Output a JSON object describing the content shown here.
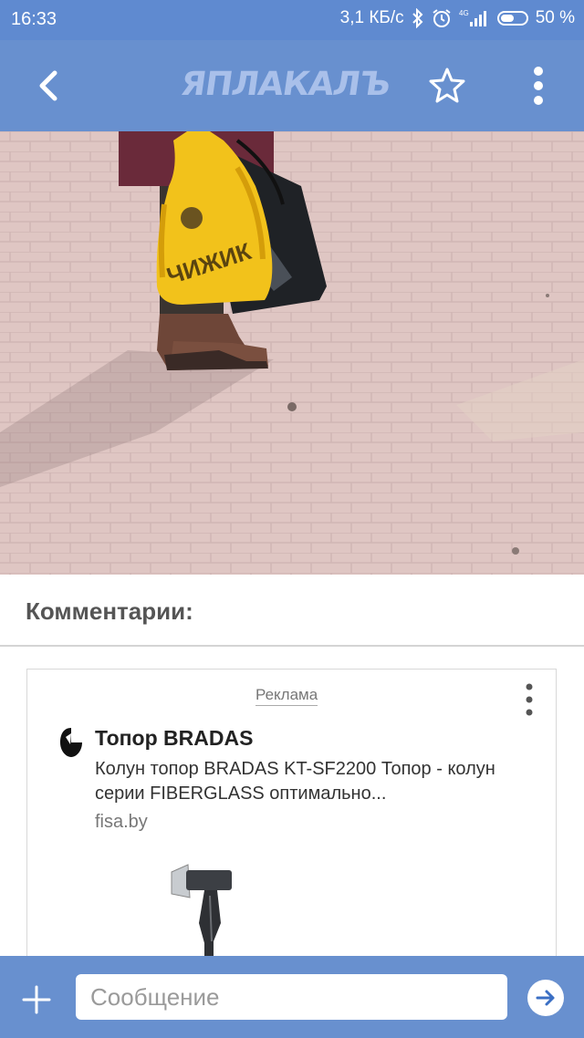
{
  "status_bar": {
    "time": "16:33",
    "speed": "3,1 КБ/с",
    "battery": "50 %",
    "icons": [
      "bluetooth-icon",
      "alarm-icon",
      "signal-4g-icon",
      "battery-icon"
    ]
  },
  "app_bar": {
    "logo": "ЯПЛАКАЛЪ",
    "back_icon": "chevron-left-icon",
    "favorite_icon": "star-outline-icon",
    "menu_icon": "more-vertical-icon"
  },
  "post": {
    "photo_bag_text": "ЧИЖИК"
  },
  "comments": {
    "title": "Комментарии:"
  },
  "ad": {
    "label": "Реклама",
    "title": "Топор BRADAS",
    "description": "Колун топор BRADAS KT-SF2200 Топор - колун серии FIBERGLASS оптимально...",
    "domain": "fisa.by"
  },
  "composer": {
    "placeholder": "Сообщение",
    "add_icon": "plus-icon",
    "send_icon": "send-arrow-icon"
  },
  "colors": {
    "status_bar": "#5f8ad0",
    "app_bar": "#6890cf",
    "accent": "#3b6fc4"
  }
}
